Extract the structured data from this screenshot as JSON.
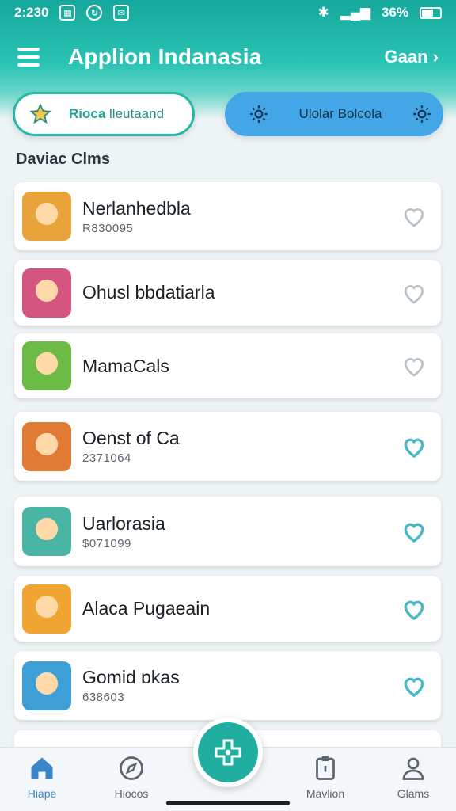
{
  "status_bar": {
    "time": "2:230",
    "battery": "36%"
  },
  "app_bar": {
    "title": "Applion Indanasia",
    "action": "Gaan ›"
  },
  "segments": {
    "left": {
      "label_bold": "Rioca",
      "label_rest": " lleutaand"
    },
    "right": {
      "label": "Ulolar Bolcola"
    }
  },
  "section_title": "Daviac Clms",
  "games": [
    {
      "name": "Nerlanhedbla",
      "sub": "R830095",
      "favorited": false,
      "thumb_color": "#e8a33a"
    },
    {
      "name": "Ohusl bbdatiarla",
      "sub": "",
      "favorited": false,
      "thumb_color": "#d4557f"
    },
    {
      "name": "MamaCals",
      "sub": "",
      "favorited": false,
      "thumb_color": "#6dbb47"
    },
    {
      "name": "Oenst of Ca",
      "sub": "2371064",
      "favorited": true,
      "thumb_color": "#e07a35"
    },
    {
      "name": "Uarlorasia",
      "sub": "$071099",
      "favorited": true,
      "thumb_color": "#4bb5a5"
    },
    {
      "name": "Alaca Pugaeain",
      "sub": "",
      "favorited": true,
      "thumb_color": "#f0a431"
    },
    {
      "name": "Gomid ɒkas",
      "sub": "638603",
      "favorited": true,
      "thumb_color": "#3d9fd6"
    }
  ],
  "bottom_nav": [
    {
      "label": "Hiape",
      "icon": "home-icon",
      "active": true
    },
    {
      "label": "Hiocos",
      "icon": "compass-icon",
      "active": false
    },
    {
      "label": "Mavlion",
      "icon": "clipboard-icon",
      "active": false
    },
    {
      "label": "Glams",
      "icon": "person-icon",
      "active": false
    }
  ],
  "colors": {
    "accent": "#1fae9f",
    "heart_active": "#48b8c9",
    "heart_inactive": "#b8c0c6",
    "nav_active": "#3a86c8"
  }
}
